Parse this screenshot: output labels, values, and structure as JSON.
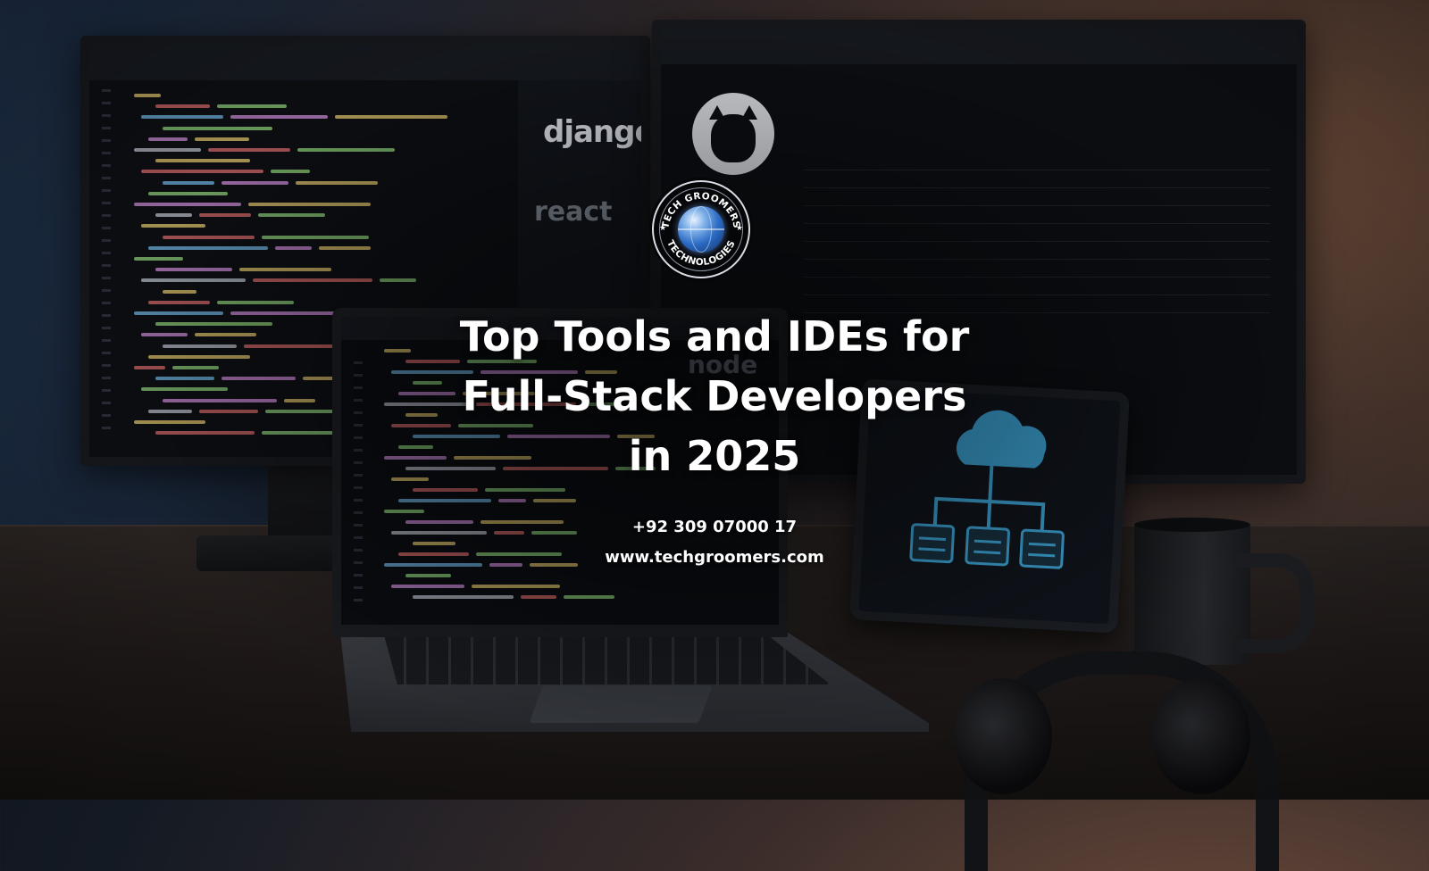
{
  "headline": {
    "line1": "Top Tools and IDEs for",
    "line2": "Full-Stack Developers",
    "line3": "in 2025"
  },
  "contact": {
    "phone": "+92 309 07000 17",
    "website": "www.techgroomers.com"
  },
  "logo": {
    "top_text": "TECH GROOMERS",
    "bottom_text": "TECHNOLOGIES",
    "icon": "globe-icon"
  },
  "background": {
    "monitor_left_logos": [
      "django",
      "react"
    ],
    "laptop_logo": "node",
    "monitor_right_icon": "github-icon",
    "tablet_icon": "cloud-network-icon"
  },
  "colors": {
    "headline": "#ffffff",
    "accent_blue": "#3ea6d8",
    "background_dark": "#0c1018"
  }
}
